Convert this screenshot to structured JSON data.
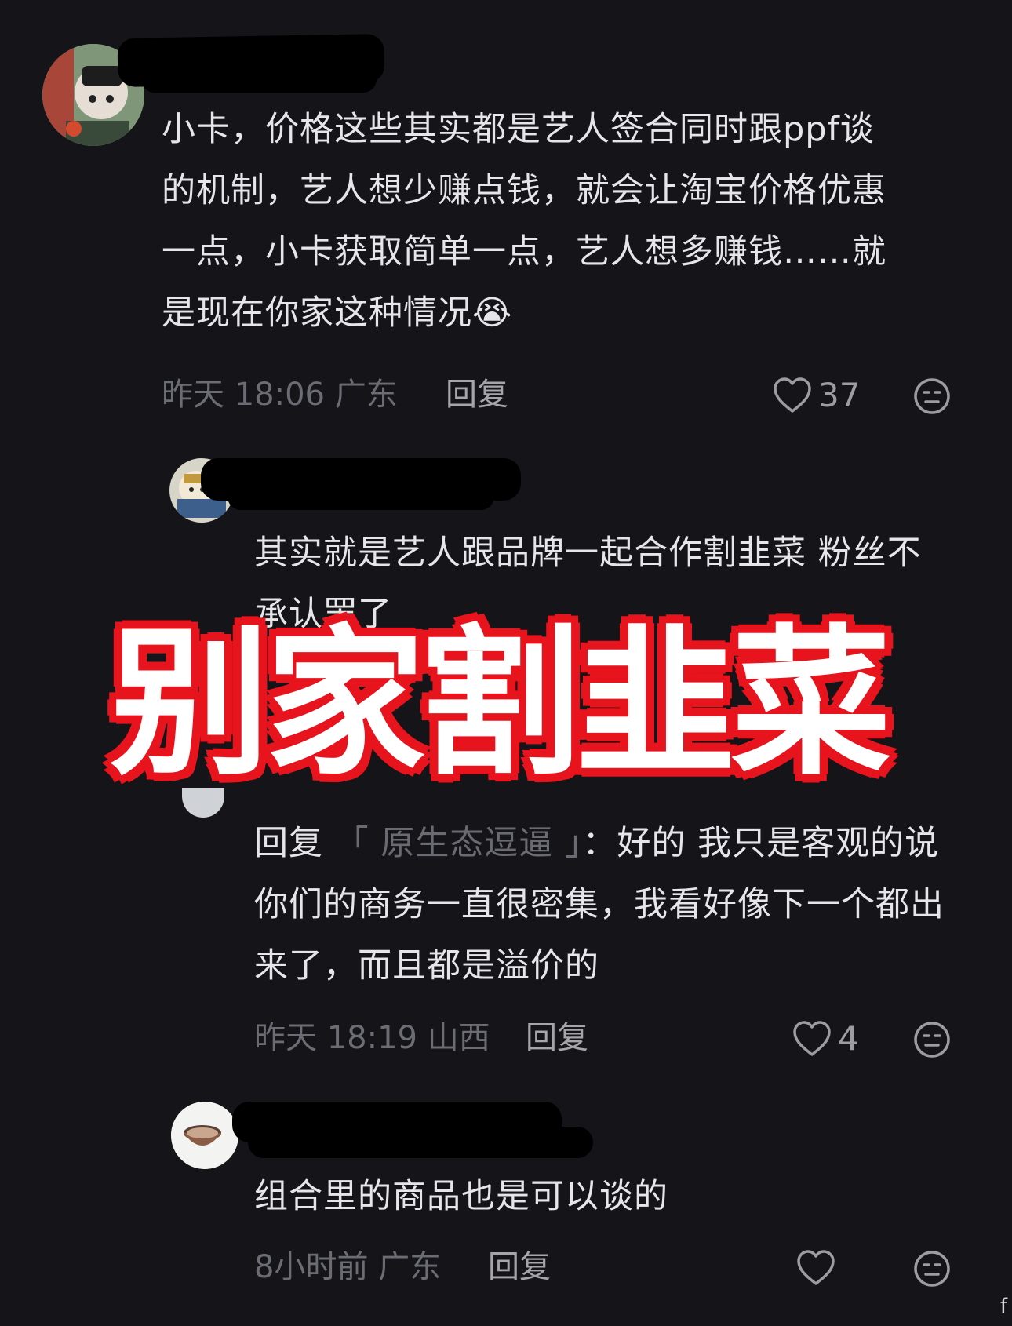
{
  "comments": [
    {
      "text": "小卡，价格这些其实都是艺人签合同时跟ppf谈的机制，艺人想少赚点钱，就会让淘宝价格优惠一点，小卡获取简单一点，艺人想多赚钱……就是现在你家这种情况",
      "emoji": "😭",
      "time": "昨天 18:06",
      "location": "广东",
      "reply_label": "回复",
      "likes": "37"
    },
    {
      "text": "其实就是艺人跟品牌一起合作割韭菜 粉丝不承认罢了"
    },
    {
      "reply_prefix": "回复",
      "quoted_name": "「 原生态逗逼 」",
      "reply_sep": "：",
      "text": "好的  我只是客观的说  你们的商务一直很密集，我看好像下一个都出来了，而且都是溢价的",
      "time": "昨天 18:19",
      "location": "山西",
      "reply_label": "回复",
      "likes": "4"
    },
    {
      "text": "组合里的商品也是可以谈的",
      "time": "8小时前",
      "location": "广东",
      "reply_label": "回复",
      "likes": ""
    }
  ],
  "overlay_caption": "别家割韭菜",
  "corner_mark": "f",
  "icons": {
    "like": "heart-outline-icon",
    "dislike": "neutral-face-icon"
  },
  "colors": {
    "background": "#151519",
    "overlay_text": "#ffffff",
    "overlay_outline": "#e8141d",
    "meta_text": "#6c6c74"
  }
}
